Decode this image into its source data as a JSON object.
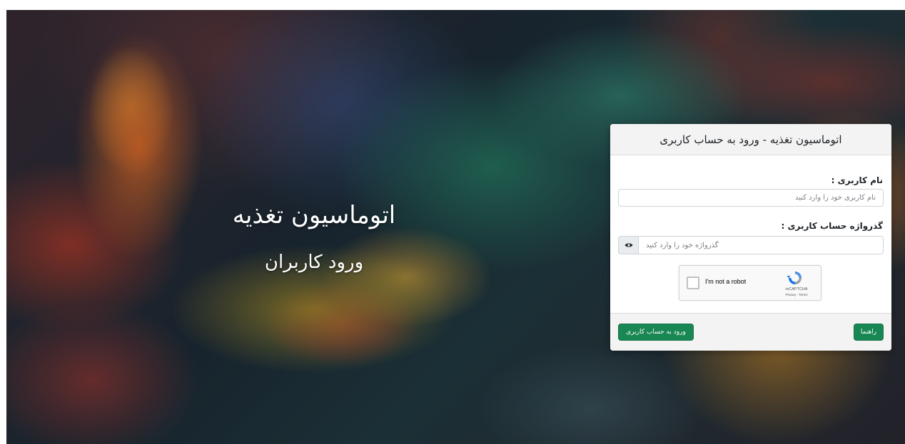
{
  "hero": {
    "title": "اتوماسیون تغذیه",
    "subtitle": "ورود کاربران"
  },
  "login_card": {
    "header": "اتوماسیون تغذیه - ورود به حساب کاربری",
    "username_label": "نام کاربری :",
    "username_placeholder": "نام کاربری خود را وارد کنید",
    "password_label": "گذرواژه حساب کاربری :",
    "password_placeholder": "گذرواژه خود را وارد کنید",
    "captcha": {
      "label": "I'm not a robot",
      "brand": "reCAPTCHA",
      "links": "Privacy - Terms"
    },
    "help_button": "راهنما",
    "login_button": "ورود به حساب کاربری"
  },
  "colors": {
    "primary_button": "#198754",
    "card_header_bg": "#f3f3f3"
  },
  "icons": {
    "password_toggle": "eye-icon",
    "captcha_logo": "recaptcha-logo-icon"
  }
}
